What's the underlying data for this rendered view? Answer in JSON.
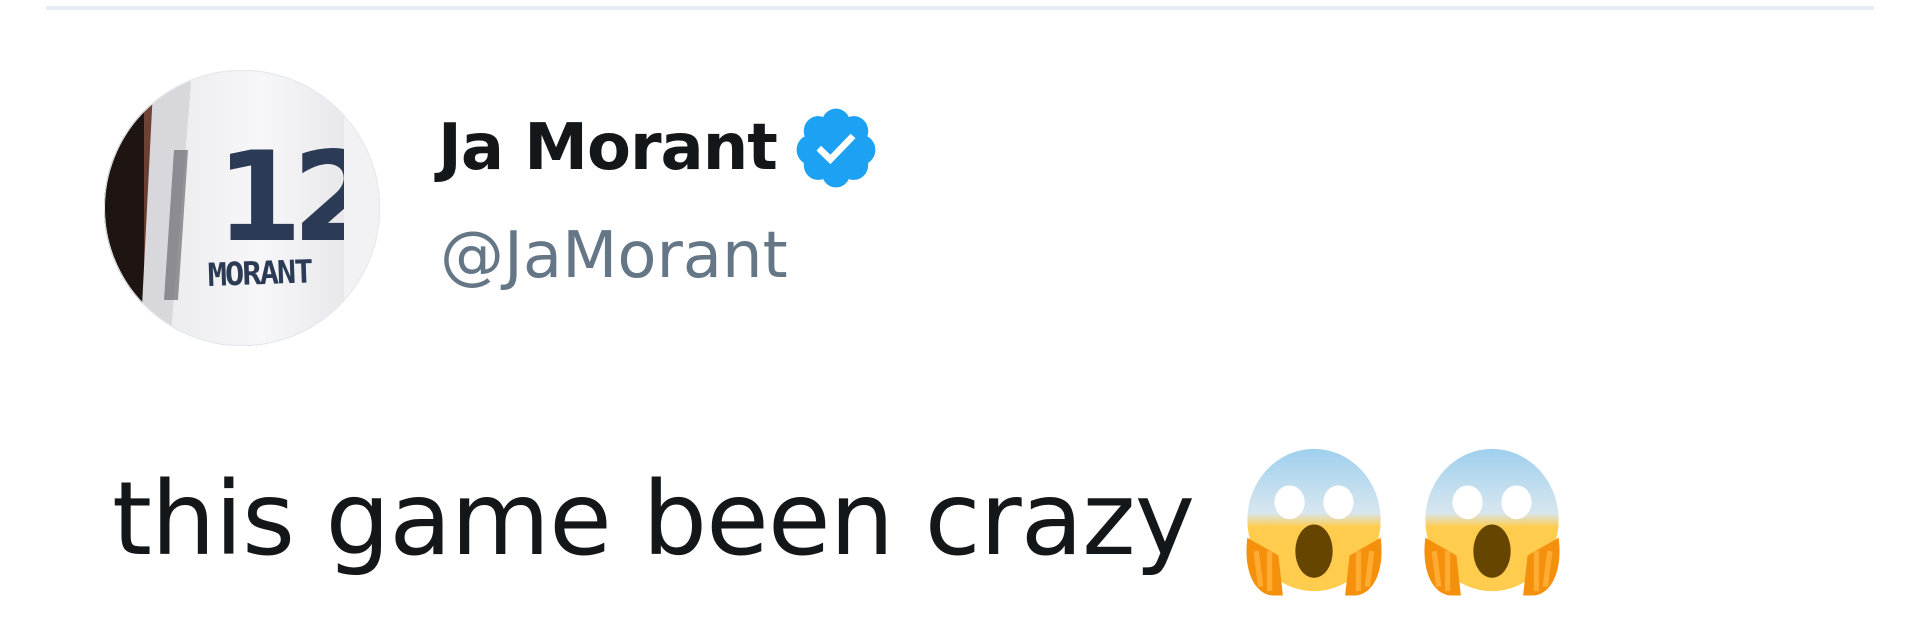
{
  "tweet": {
    "author": {
      "display_name": "Ja Morant",
      "handle": "@JaMorant",
      "verified": true,
      "avatar": {
        "jersey_number": "12",
        "jersey_name": "MORANT",
        "jersey_color": "#2b3a55"
      }
    },
    "text": "this game been crazy",
    "emojis": [
      "face-screaming-in-fear-icon",
      "face-screaming-in-fear-icon"
    ]
  },
  "colors": {
    "name": "#14171a",
    "handle": "#657786",
    "verified_badge": "#1da1f2",
    "divider": "#e6ecf0"
  }
}
